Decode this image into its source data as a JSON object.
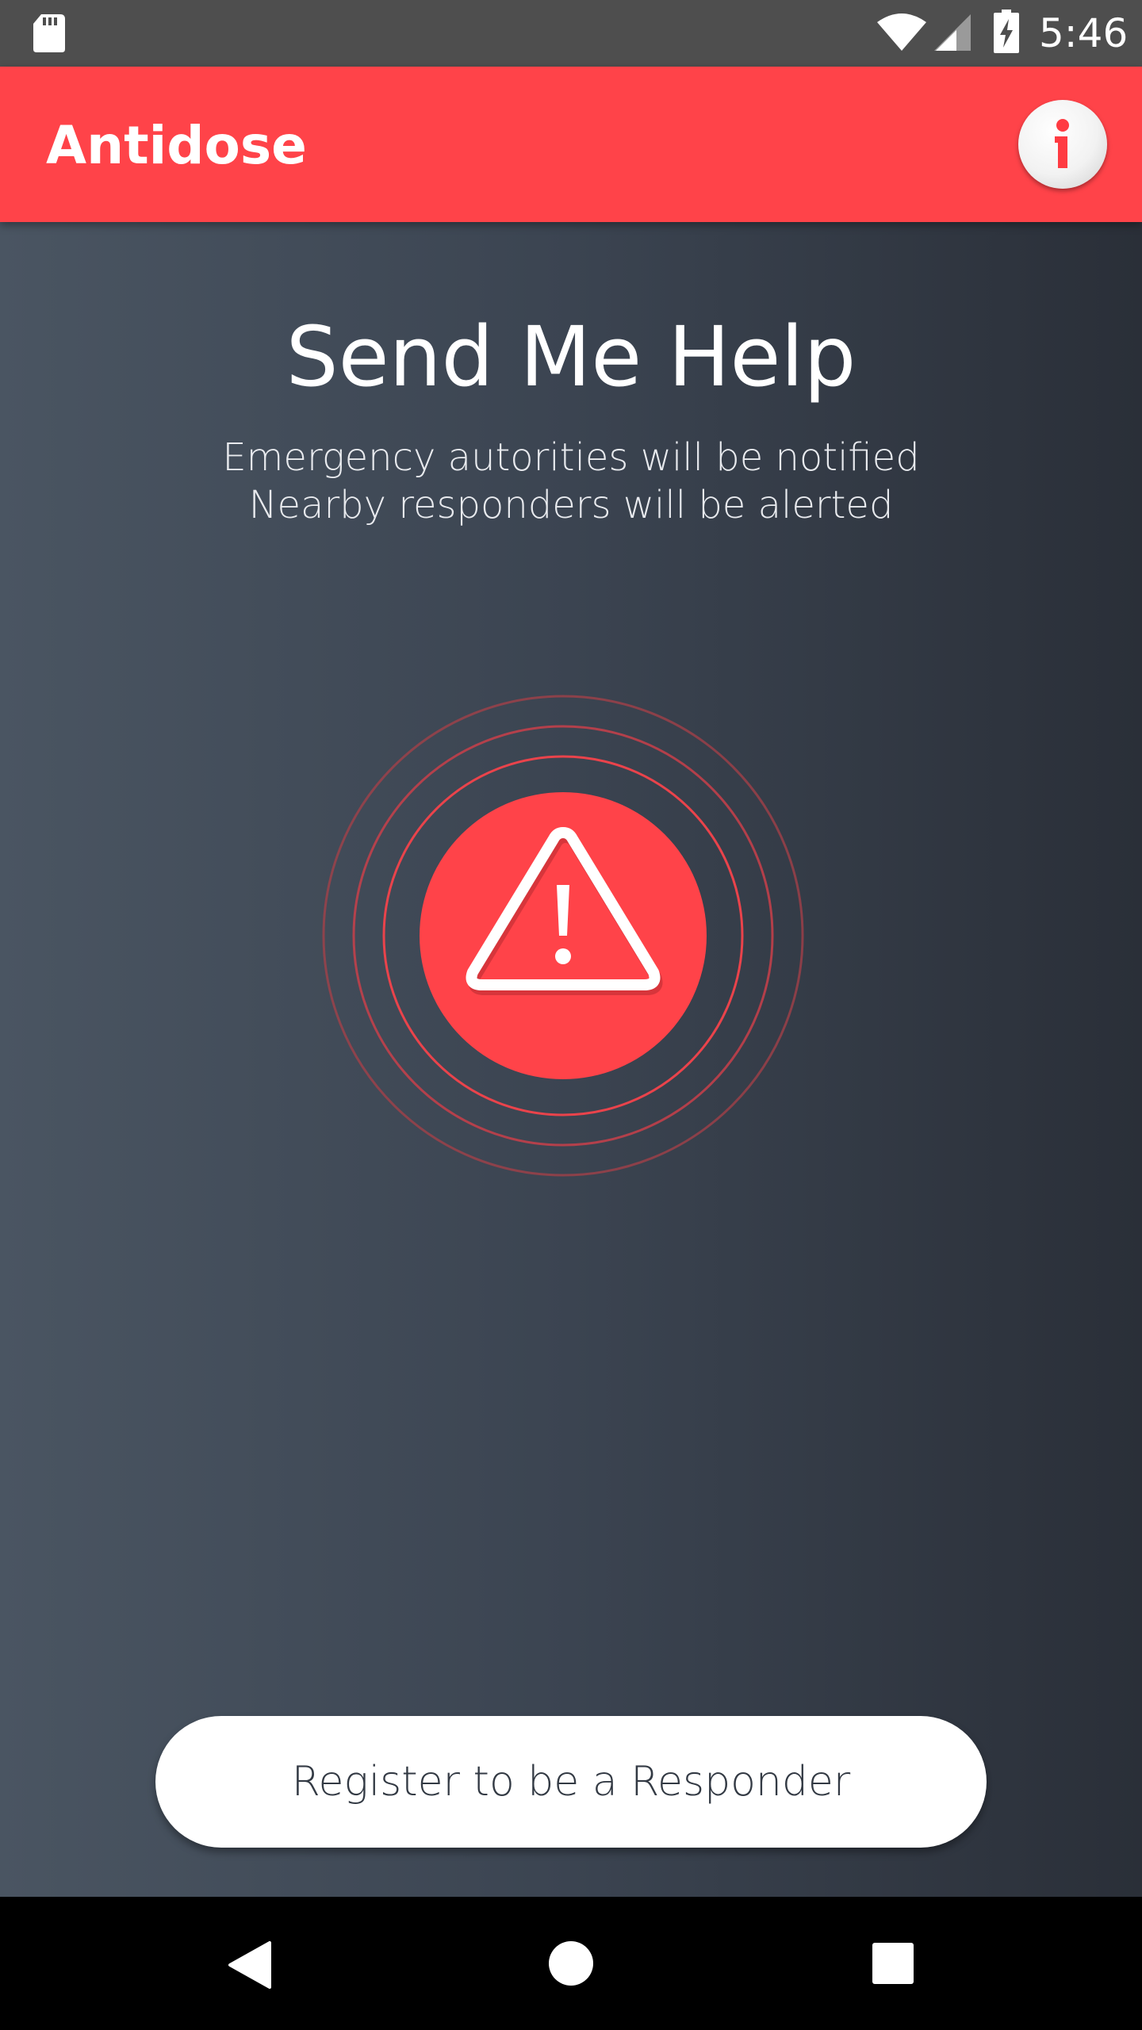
{
  "status_bar": {
    "time": "5:46",
    "icons": [
      "sd-card-icon",
      "wifi-icon",
      "cell-signal-icon",
      "battery-charging-icon"
    ]
  },
  "app_bar": {
    "title": "Antidose",
    "info_icon": "info-icon"
  },
  "main": {
    "headline": "Send Me Help",
    "subtitle_lines": [
      "Emergency autorities will be notified",
      "Nearby responders will be alerted"
    ],
    "help_button_icon": "warning-triangle-icon",
    "register_label": "Register to be a Responder"
  },
  "nav_bar": {
    "icons": [
      "back-icon",
      "home-icon",
      "recents-icon"
    ]
  },
  "colors": {
    "accent": "#ff4349",
    "status_bar": "#4e4e4e",
    "content_bg_left": "#4a5562",
    "content_bg_right": "#2a2f38",
    "button_bg": "#ffffff",
    "nav_bar": "#000000"
  }
}
